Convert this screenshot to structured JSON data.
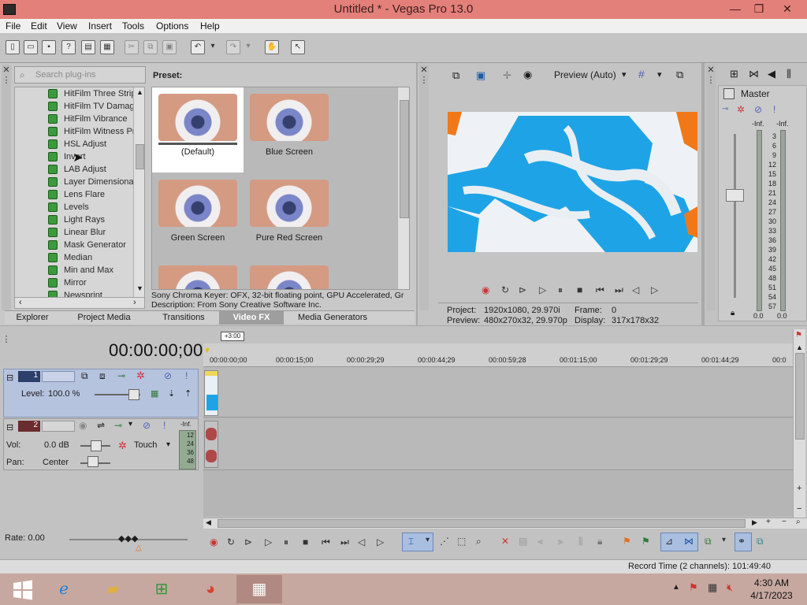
{
  "window": {
    "title": "Untitled * - Vegas Pro 13.0",
    "min": "—",
    "max": "❐",
    "close": "✕"
  },
  "menu": [
    "File",
    "Edit",
    "View",
    "Insert",
    "Tools",
    "Options",
    "Help"
  ],
  "plugins": {
    "search_placeholder": "Search plug-ins",
    "items": [
      "HitFilm Three Strip",
      "HitFilm TV Damage",
      "HitFilm Vibrance",
      "HitFilm Witness Pr",
      "HSL Adjust",
      "Invert",
      "LAB Adjust",
      "Layer Dimensional",
      "Lens Flare",
      "Levels",
      "Light Rays",
      "Linear Blur",
      "Mask Generator",
      "Median",
      "Min and Max",
      "Mirror",
      "Newsprint"
    ]
  },
  "preset": {
    "label": "Preset:",
    "items": [
      "(Default)",
      "Blue Screen",
      "Green Screen",
      "Pure Red Screen"
    ],
    "info_line1": "Sony Chroma Keyer: OFX, 32-bit floating point, GPU Accelerated, Gr",
    "info_line2": "Description: From Sony Creative Software Inc."
  },
  "tabs": [
    "Explorer",
    "Project Media",
    "Transitions",
    "Video FX",
    "Media Generators"
  ],
  "preview": {
    "mode": "Preview (Auto)",
    "project_label": "Project:",
    "project_value": "1920x1080, 29.970i",
    "frame_label": "Frame:",
    "frame_value": "0",
    "preview_label": "Preview:",
    "preview_value": "480x270x32, 29.970p",
    "display_label": "Display:",
    "display_value": "317x178x32"
  },
  "master": {
    "title": "Master",
    "left_top": "-Inf.",
    "right_top": "-Inf.",
    "scale": [
      "3",
      "6",
      "9",
      "12",
      "15",
      "18",
      "21",
      "24",
      "27",
      "30",
      "33",
      "36",
      "39",
      "42",
      "45",
      "48",
      "51",
      "54",
      "57"
    ],
    "left_bottom": "0.0",
    "right_bottom": "0.0"
  },
  "timeline": {
    "timecode": "00:00:00;00",
    "marker": "+3:00",
    "ruler": [
      "00:00:00;00",
      "00:00:15;00",
      "00:00:29;29",
      "00:00:44;29",
      "00:00:59;28",
      "00:01:15;00",
      "00:01:29;29",
      "00:01:44;29",
      "00:0"
    ],
    "video_track": {
      "number": "1",
      "level_label": "Level:",
      "level_value": "100.0 %"
    },
    "audio_track": {
      "number": "2",
      "vol_label": "Vol:",
      "vol_value": "0.0 dB",
      "pan_label": "Pan:",
      "pan_value": "Center",
      "mode": "Touch",
      "meter_top": "-Inf.",
      "meter_vals": [
        "12",
        "24",
        "36",
        "48"
      ]
    },
    "rate": "Rate: 0.00"
  },
  "status": {
    "record_time": "Record Time (2 channels): 101:49:40"
  },
  "taskbar": {
    "time": "4:30 AM",
    "date": "4/17/2023"
  },
  "colors": {
    "title_bar": "#e3807a",
    "tab_active": "#9e9e9e",
    "video_track": "#b6c3de",
    "key_blue": "#1ea4e6",
    "key_orange": "#f07818"
  }
}
